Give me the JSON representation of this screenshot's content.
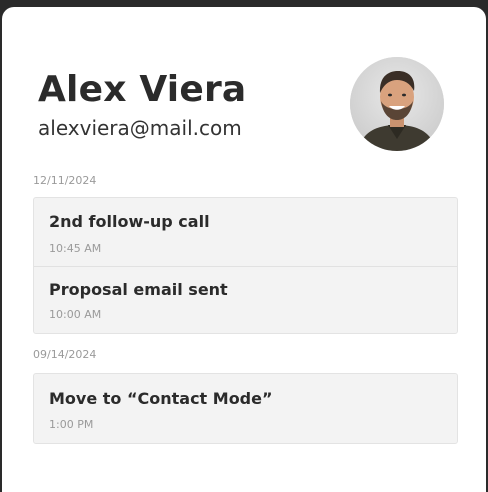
{
  "contact": {
    "name": "Alex Viera",
    "email": "alexviera@mail.com"
  },
  "timeline": [
    {
      "date": "12/11/2024",
      "entries": [
        {
          "title": "2nd follow-up call",
          "time": "10:45 AM"
        },
        {
          "title": "Proposal email sent",
          "time": "10:00 AM"
        }
      ]
    },
    {
      "date": "09/14/2024",
      "entries": [
        {
          "title": "Move to “Contact Mode”",
          "time": "1:00 PM"
        }
      ]
    }
  ],
  "colors": {
    "background": "#2a2a2a",
    "card": "#ffffff",
    "entry_bg": "#f3f3f3",
    "text_primary": "#2b2b2b",
    "text_muted": "#9a9a9a"
  }
}
